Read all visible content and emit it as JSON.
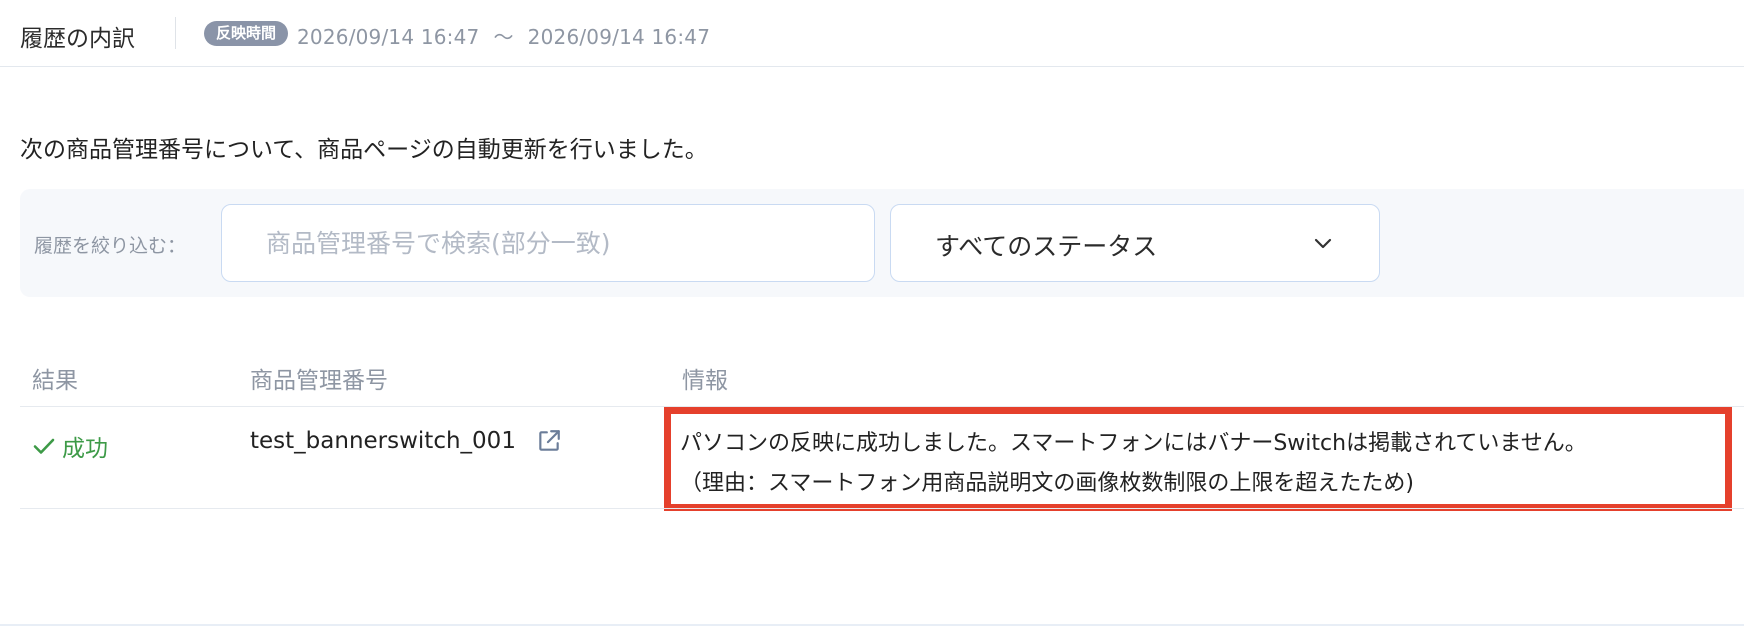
{
  "header": {
    "title": "履歴の内訳",
    "badge": "反映時間",
    "time_start": "2026/09/14 16:47",
    "time_separator": "〜",
    "time_end": "2026/09/14 16:47"
  },
  "description": "次の商品管理番号について、商品ページの自動更新を行いました。",
  "filter": {
    "label": "履歴を絞り込む：",
    "search_placeholder": "商品管理番号で検索(部分一致)",
    "search_value": "",
    "status_selected": "すべてのステータス"
  },
  "table": {
    "columns": [
      "結果",
      "商品管理番号",
      "情報"
    ],
    "rows": [
      {
        "result": "成功",
        "product_id": "test_bannerswitch_001",
        "info_line1": "パソコンの反映に成功しました。スマートフォンにはバナーSwitchは掲載されていません。",
        "info_line2": "（理由：スマートフォン用商品説明文の画像枚数制限の上限を超えたため)"
      }
    ]
  },
  "colors": {
    "success": "#3d9a47",
    "highlight": "#e5402c",
    "badge_bg": "#8a94a8",
    "muted_text": "#8e96a3"
  },
  "icons": {
    "result": "check-icon",
    "product_link": "external-link-icon",
    "select": "chevron-down-icon"
  }
}
